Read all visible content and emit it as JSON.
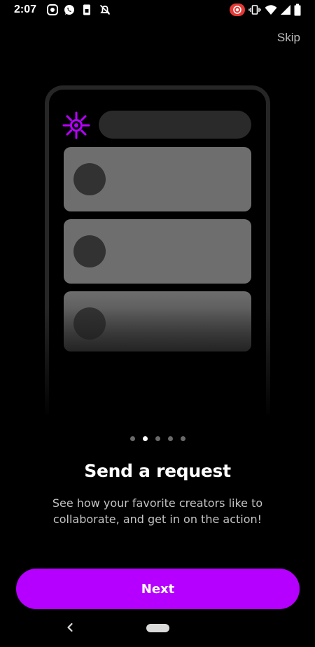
{
  "status_bar": {
    "time": "2:07",
    "left_icons": [
      "screen-record-icon",
      "whatsapp-icon",
      "sim-icon",
      "notifications-off-icon"
    ],
    "right_icons": [
      "recording-indicator-icon",
      "vibrate-icon",
      "wifi-icon",
      "signal-icon",
      "battery-icon"
    ],
    "recording_color": "#e53935"
  },
  "header": {
    "skip_label": "Skip"
  },
  "illustration": {
    "accent_color": "#b600ff",
    "cards": 3
  },
  "pager": {
    "total": 5,
    "active_index": 1
  },
  "content": {
    "title": "Send a request",
    "subtitle": "See how your favorite creators like to collaborate, and get in on the action!"
  },
  "footer": {
    "next_label": "Next",
    "accent_color": "#b600ff"
  },
  "nav_bar": {
    "icons": [
      "back-icon",
      "home-pill-icon"
    ]
  }
}
